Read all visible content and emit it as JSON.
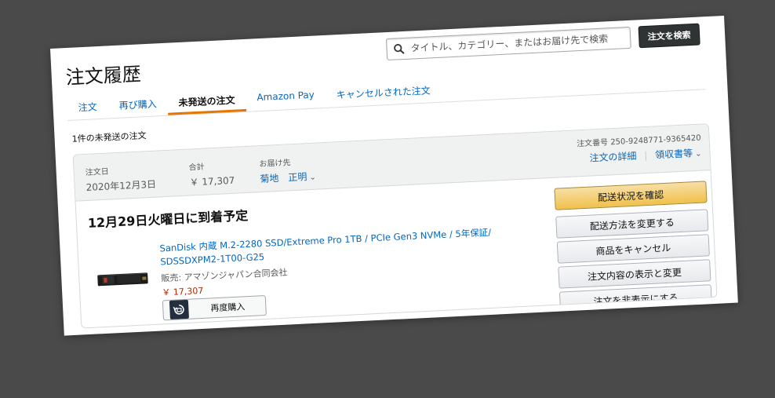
{
  "page": {
    "title": "注文履歴"
  },
  "search": {
    "placeholder": "タイトル、カテゴリー、またはお届け先で検索",
    "button_label": "注文を検索",
    "icon": "search-icon"
  },
  "tabs": [
    {
      "label": "注文",
      "active": false
    },
    {
      "label": "再び購入",
      "active": false
    },
    {
      "label": "未発送の注文",
      "active": true
    },
    {
      "label": "Amazon Pay",
      "active": false
    },
    {
      "label": "キャンセルされた注文",
      "active": false
    }
  ],
  "summary": {
    "count_text": "1件の未発送の注文"
  },
  "order": {
    "date_label": "注文日",
    "date_value": "2020年12月3日",
    "total_label": "合計",
    "total_value": "￥ 17,307",
    "ship_to_label": "お届け先",
    "ship_to_value": "菊地　正明",
    "order_number": "注文番号 250-9248771-9365420",
    "details_link": "注文の詳細",
    "receipt_link": "領収書等",
    "arrival": "12月29日火曜日に到着予定",
    "product_title": "SanDisk 内蔵 M.2-2280 SSD/Extreme Pro 1TB / PCIe Gen3 NVMe / 5年保証/ SDSSDXPM2-1T00-G25",
    "seller": "販売: アマゾンジャパン合同会社",
    "price": "￥ 17,307",
    "rebuy_label": "再度購入"
  },
  "actions": [
    {
      "label": "配送状況を確認",
      "style": "primary"
    },
    {
      "label": "配送方法を変更する",
      "style": "secondary"
    },
    {
      "label": "商品をキャンセル",
      "style": "secondary"
    },
    {
      "label": "注文内容の表示と変更",
      "style": "secondary"
    },
    {
      "label": "注文を非表示にする",
      "style": "secondary"
    }
  ],
  "colors": {
    "background": "#4a4a4a",
    "link": "#0066c0",
    "price": "#b12704",
    "tab_active_underline": "#e77600",
    "primary_button": "#f0c14b",
    "search_button": "#303333"
  }
}
